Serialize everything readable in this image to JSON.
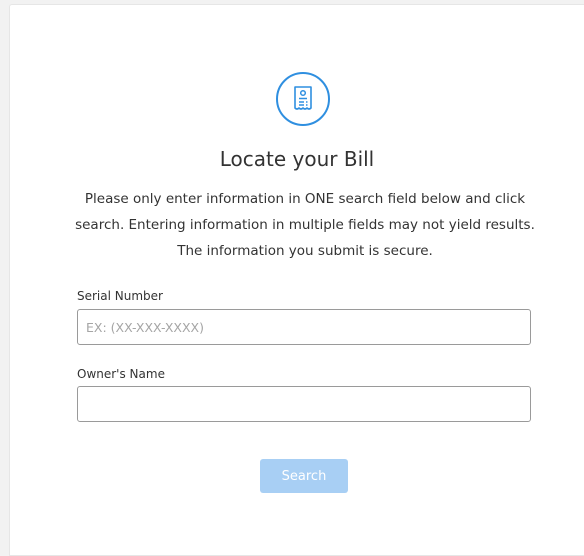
{
  "header": {
    "icon": "receipt-icon",
    "title": "Locate your Bill",
    "intro": "Please only enter information in ONE search field below and click search. Entering information in multiple fields may not yield results. The information you submit is secure."
  },
  "form": {
    "serial": {
      "label": "Serial Number",
      "placeholder": "EX: (XX-XXX-XXXX)",
      "value": ""
    },
    "owner": {
      "label": "Owner's Name",
      "placeholder": "",
      "value": ""
    },
    "search_label": "Search"
  },
  "colors": {
    "accent": "#2f8fe0",
    "button_disabled": "#a8cff4",
    "background": "#f2f2f2",
    "card": "#ffffff"
  }
}
